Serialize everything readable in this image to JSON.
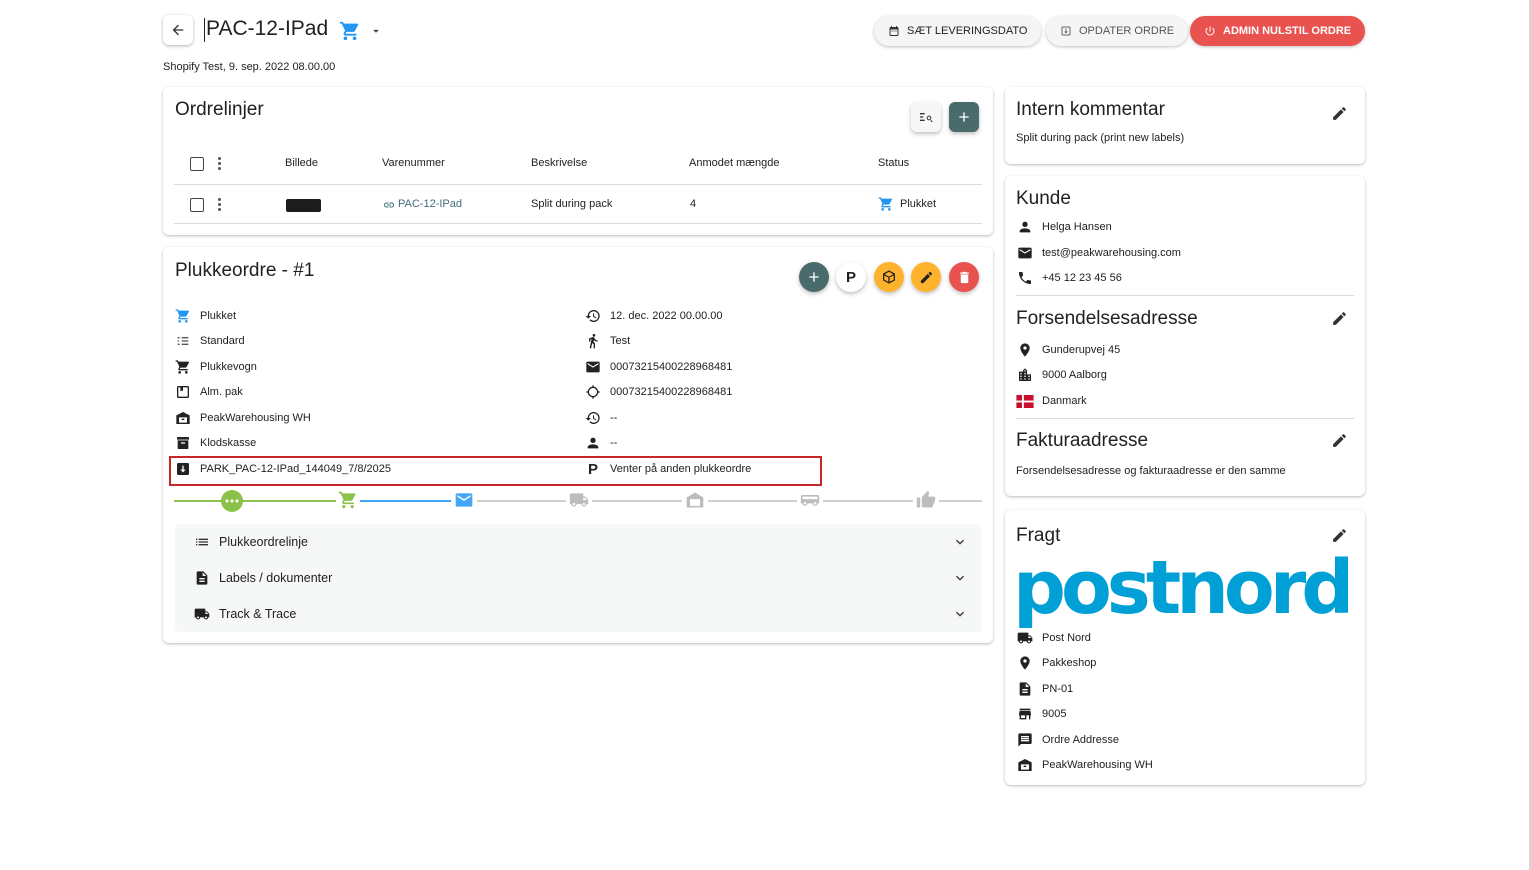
{
  "header": {
    "title": "PAC-12-IPad",
    "subtitle": "Shopify Test, 9. sep. 2022 08.00.00",
    "buttons": {
      "set_delivery": "SÆT LEVERINGSDATO",
      "update_order": "OPDATER ORDRE",
      "admin_reset": "ADMIN NULSTIL ORDRE"
    }
  },
  "orderlines": {
    "title": "Ordrelinjer",
    "columns": [
      "Billede",
      "Varenummer",
      "Beskrivelse",
      "Anmodet mængde",
      "Status"
    ],
    "rows": [
      {
        "sku": "PAC-12-IPad",
        "description": "Split during pack",
        "quantity": "4",
        "status": "Plukket"
      }
    ]
  },
  "pickorder": {
    "title": "Plukkeordre - #1",
    "fab_p": "P",
    "left": [
      {
        "icon": "cart-icon",
        "text": "Plukket"
      },
      {
        "icon": "list-icon",
        "text": "Standard"
      },
      {
        "icon": "trolley-icon",
        "text": "Plukkevogn"
      },
      {
        "icon": "package-icon",
        "text": "Alm. pak"
      },
      {
        "icon": "warehouse-icon",
        "text": "PeakWarehousing WH"
      },
      {
        "icon": "box-icon",
        "text": "Klodskasse"
      },
      {
        "icon": "download-box-icon",
        "text": "PARK_PAC-12-IPad_144049_7/8/2025"
      }
    ],
    "right": [
      {
        "icon": "history-icon",
        "text": "12. dec. 2022 00.00.00"
      },
      {
        "icon": "person-walk-icon",
        "text": "Test"
      },
      {
        "icon": "mail-icon",
        "text": "00073215400228968481"
      },
      {
        "icon": "circle-icon",
        "text": "00073215400228968481"
      },
      {
        "icon": "history-icon",
        "text": "--"
      },
      {
        "icon": "person-icon",
        "text": "--"
      },
      {
        "icon": "parking-icon",
        "text": "Venter på anden plukkeordre"
      }
    ],
    "accordions": [
      "Plukkeordrelinje",
      "Labels / dokumenter",
      "Track & Trace"
    ],
    "colors": {
      "done": "#8bc34a",
      "active": "#42a5f5",
      "pending": "#bdbdbd"
    }
  },
  "comment": {
    "title": "Intern kommentar",
    "text": "Split during pack (print new labels)"
  },
  "customer": {
    "title": "Kunde",
    "name": "Helga Hansen",
    "email": "test@peakwarehousing.com",
    "phone": "+45 12 23 45 56"
  },
  "shipping": {
    "title": "Forsendelsesadresse",
    "street": "Gunderupvej 45",
    "city": "9000 Aalborg",
    "country": "Danmark"
  },
  "billing": {
    "title": "Fakturaadresse",
    "text": "Forsendelsesadresse og fakturaadresse er den samme"
  },
  "freight": {
    "title": "Fragt",
    "logo_text": "postnord",
    "carrier": "Post Nord",
    "type": "Pakkeshop",
    "code": "PN-01",
    "shop": "9005",
    "address_label": "Ordre Addresse",
    "warehouse": "PeakWarehousing WH"
  },
  "colors": {
    "teal": "#4a6b6b",
    "red": "#e8524f",
    "orange": "#ffb22b",
    "link": "#3f6d7d",
    "cart_blue": "#2196f3",
    "postnord": "#00a0d6"
  }
}
